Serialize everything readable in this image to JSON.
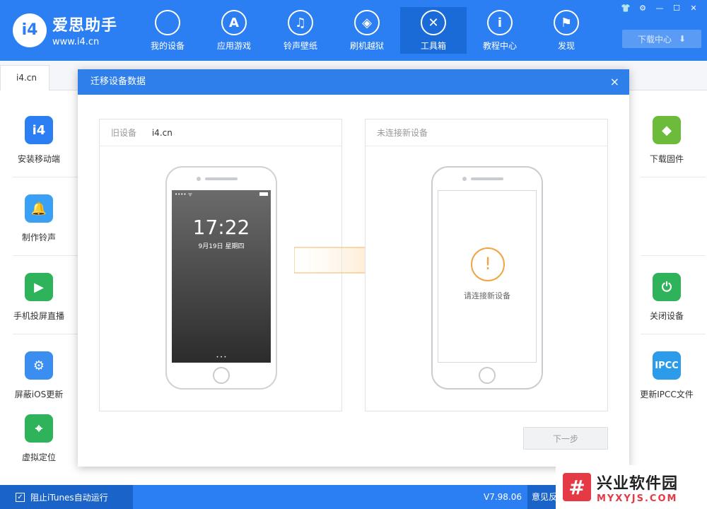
{
  "app": {
    "logo_badge": "i4",
    "logo_title": "爱思助手",
    "logo_url": "www.i4.cn"
  },
  "nav": [
    {
      "label": "我的设备",
      "icon": "apple-icon",
      "glyph": ""
    },
    {
      "label": "应用游戏",
      "icon": "app-store-icon",
      "glyph": "A"
    },
    {
      "label": "铃声壁纸",
      "icon": "music-folder-icon",
      "glyph": "♫"
    },
    {
      "label": "刷机越狱",
      "icon": "box-icon",
      "glyph": "◈"
    },
    {
      "label": "工具箱",
      "icon": "tools-icon",
      "glyph": "✕"
    },
    {
      "label": "教程中心",
      "icon": "info-icon",
      "glyph": "i"
    },
    {
      "label": "发现",
      "icon": "flag-icon",
      "glyph": "⚑"
    }
  ],
  "active_nav": "工具箱",
  "window_controls": [
    "tshirt-icon",
    "gear-icon",
    "minimize-icon",
    "maximize-icon",
    "close-icon"
  ],
  "download_center": {
    "label": "下载中心",
    "icon": "download-icon"
  },
  "tab": {
    "label": "i4.cn"
  },
  "tools_left": [
    {
      "label": "安装移动端",
      "glyph": "i4",
      "color": "#2b7ff2"
    },
    {
      "label": "制作铃声",
      "glyph": "🔔",
      "color": "#3aa0f5"
    },
    {
      "label": "手机投屏直播",
      "glyph": "▶",
      "color": "#2fb35a"
    },
    {
      "label": "屏蔽iOS更新",
      "glyph": "⚙",
      "color": "#3a8ef0"
    },
    {
      "label": "虚拟定位",
      "glyph": "⌖",
      "color": "#2fb35a"
    }
  ],
  "tools_right": [
    {
      "label": "下载固件",
      "glyph": "◆",
      "color": "#6dbb3a"
    },
    {
      "label": "关闭设备",
      "glyph": "⏻",
      "color": "#2fb35a"
    },
    {
      "label": "更新IPCC文件",
      "glyph": "IPCC",
      "color": "#2b9bea"
    }
  ],
  "dialog": {
    "title": "迁移设备数据",
    "close": "×",
    "old_device": {
      "label": "旧设备",
      "name": "i4.cn",
      "lock_time": "17:22",
      "lock_date": "9月19日 星期四"
    },
    "new_device": {
      "label": "未连接新设备",
      "warning_glyph": "!",
      "message": "请连接新设备"
    },
    "next_button": "下一步"
  },
  "bottom": {
    "itunes_label": "阻止iTunes自动运行",
    "itunes_checked": true,
    "version": "V7.98.06",
    "feedback": "意见反"
  },
  "watermark": {
    "logo_glyph": "#",
    "title": "兴业软件园",
    "url": "MYXYJS.COM"
  },
  "colors": {
    "brand_blue": "#2b7ff2",
    "warning_orange": "#f0a442"
  }
}
